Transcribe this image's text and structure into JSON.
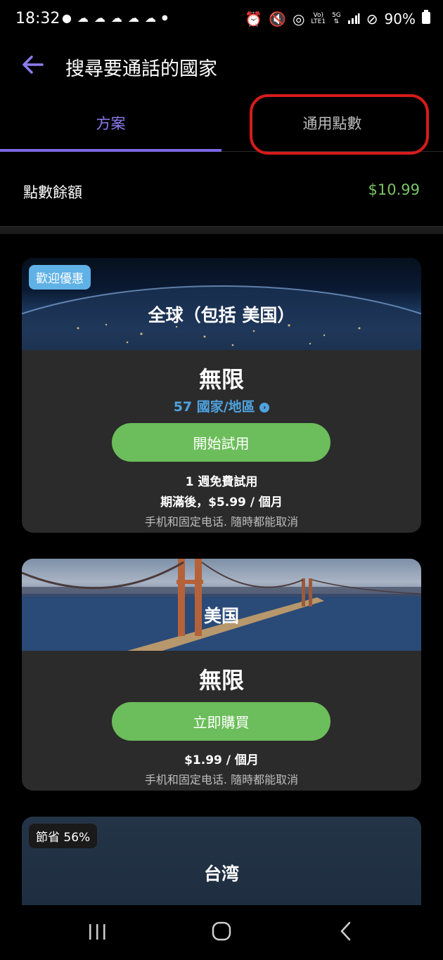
{
  "status_bar": {
    "time": "18:32",
    "battery": "90%",
    "net_top": "Vo)",
    "net_bottom": "LTE1",
    "five_g": "5G"
  },
  "header": {
    "title": "搜尋要通話的國家",
    "back_icon": "arrow-left-icon"
  },
  "tabs": [
    {
      "label": "方案",
      "active": true
    },
    {
      "label": "通用點數",
      "active": false
    }
  ],
  "balance": {
    "label": "點數餘額",
    "value": "$10.99"
  },
  "cards": [
    {
      "badge": "歡迎優惠",
      "region": "全球（包括 美国）",
      "plan": "無限",
      "countries_link": "57 國家/地區",
      "button": "開始試用",
      "line1": "1 週免費試用",
      "line2": "期滿後，$5.99 / 個月",
      "line3": "手机和固定电话. 隨時都能取消"
    },
    {
      "region": "美国",
      "plan": "無限",
      "button": "立即購買",
      "line1": "$1.99 / 個月",
      "line2": "手机和固定电话. 隨時都能取消"
    },
    {
      "badge": "節省 56%",
      "region": "台湾"
    }
  ],
  "colors": {
    "accent": "#7c68e6",
    "balance_green": "#7cc365",
    "button_green": "#6cbd5b",
    "link_blue": "#4fa3e0",
    "highlight_red": "#d61b1b"
  }
}
